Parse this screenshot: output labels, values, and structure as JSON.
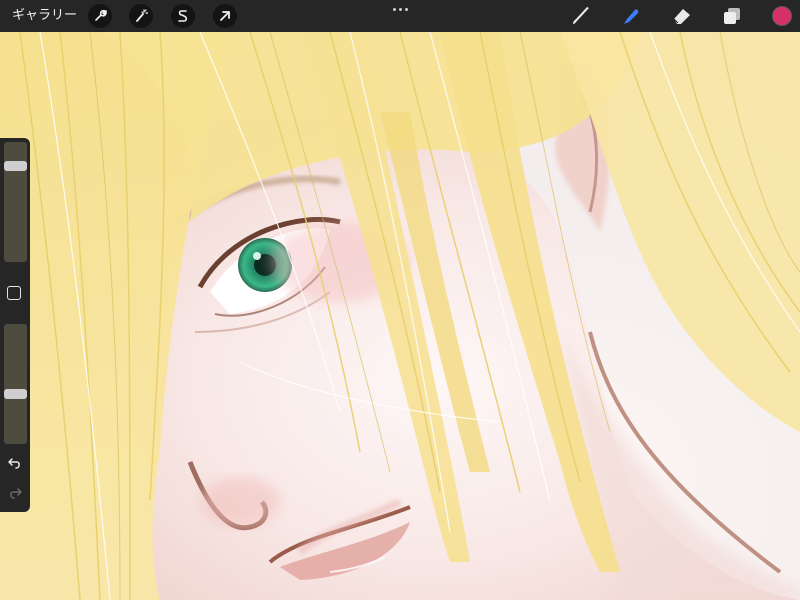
{
  "toolbar": {
    "gallery_label": "ギャラリー",
    "left_tools": [
      {
        "name": "actions-wrench-icon"
      },
      {
        "name": "adjustments-wand-icon"
      },
      {
        "name": "selection-s-icon"
      },
      {
        "name": "transform-arrow-icon"
      }
    ],
    "right_tools": [
      {
        "name": "brush-icon",
        "active": false
      },
      {
        "name": "smudge-icon",
        "active": true
      },
      {
        "name": "eraser-icon",
        "active": false
      },
      {
        "name": "layers-icon",
        "active": false
      }
    ],
    "current_color": "#d6306b",
    "active_tool_color": "#3f7dff"
  },
  "sidebar": {
    "brush_size_level": 0.83,
    "opacity_level": 0.41,
    "undo_icon": "undo-icon",
    "redo_icon": "redo-icon"
  },
  "canvas": {
    "artwork": "digital-painting"
  }
}
